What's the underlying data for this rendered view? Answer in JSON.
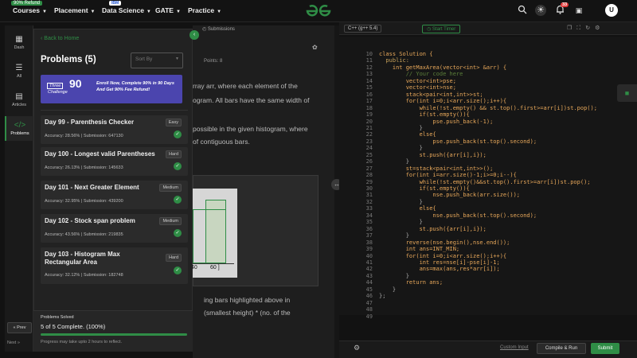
{
  "topnav": {
    "refund_badge": "90% Refund",
    "courses": "Courses",
    "placement": "Placement",
    "data_science": "Data Science",
    "ibm_badge": "IBM",
    "gate": "GATE",
    "practice": "Practice",
    "notifications": "33",
    "avatar_letter": "U"
  },
  "rail": {
    "dash": "Dash",
    "all": "All",
    "articles": "Articles",
    "problems": "Problems",
    "prev": "« Prev",
    "next": "Next »"
  },
  "description": {
    "tab_submissions": "Submissions",
    "points": "Points: 8",
    "line1": "rray arr, where each element of the",
    "line2": "ogram. All bars have the same width of",
    "line3": "possible in the given histogram, where",
    "line4": "of contiguous bars.",
    "line5": "ing bars highlighted above in",
    "line6": "(smallest height) * (no. of the",
    "hist_label1": "40",
    "hist_label2": "60 ]"
  },
  "panel": {
    "back": "Back to Home",
    "title": "Problems (5)",
    "sort_placeholder": "Sort By",
    "banner_number": "90",
    "banner_three": "Three",
    "banner_challenge": "Challenge",
    "banner_text": "Enroll Now, Complete 90% in 90 Days And Get 90% Fee Refund!",
    "problems": [
      {
        "title": "Day 99 - Parenthesis Checker",
        "difficulty": "Easy",
        "stats": "Accuracy: 28.56% | Submission: 647130"
      },
      {
        "title": "Day 100 - Longest valid Parentheses",
        "difficulty": "Hard",
        "stats": "Accuracy: 26.13% | Submission: 145633"
      },
      {
        "title": "Day 101 - Next Greater Element",
        "difficulty": "Medium",
        "stats": "Accuracy: 32.95% | Submission: 439200"
      },
      {
        "title": "Day 102 - Stock span problem",
        "difficulty": "Medium",
        "stats": "Accuracy: 43.56% | Submission: 219835"
      },
      {
        "title": "Day 103 - Histogram Max Rectangular Area",
        "difficulty": "Hard",
        "stats": "Accuracy: 32.12% | Submission: 182748"
      }
    ],
    "solved_label": "Problems Solved",
    "solved_count": "5 of 5 Complete. (100%)",
    "solved_fraction": 1.0,
    "solved_note": "Progress may take upto 2 hours to reflect."
  },
  "editor": {
    "language": "C++ (g++ 5.4)",
    "timer": "Start Timer",
    "custom_input": "Custom Input",
    "compile": "Compile & Run",
    "submit": "Submit",
    "lines": [
      {
        "n": "10",
        "t": "class Solution {",
        "c": ""
      },
      {
        "n": "11",
        "t": "  public:",
        "c": "k"
      },
      {
        "n": "12",
        "t": "    int getMaxArea(vector<int> &arr) {",
        "c": ""
      },
      {
        "n": "13",
        "t": "        // Your code here",
        "c": "c"
      },
      {
        "n": "14",
        "t": "        vector<int>pse;",
        "c": ""
      },
      {
        "n": "15",
        "t": "        vector<int>nse;",
        "c": ""
      },
      {
        "n": "16",
        "t": "        stack<pair<int,int>>st;",
        "c": ""
      },
      {
        "n": "17",
        "t": "        for(int i=0;i<arr.size();i++){",
        "c": ""
      },
      {
        "n": "18",
        "t": "            while(!st.empty() && st.top().first>=arr[i])st.pop();",
        "c": ""
      },
      {
        "n": "19",
        "t": "            if(st.empty()){",
        "c": ""
      },
      {
        "n": "20",
        "t": "                pse.push_back(-1);",
        "c": ""
      },
      {
        "n": "21",
        "t": "            }",
        "c": "p"
      },
      {
        "n": "22",
        "t": "            else{",
        "c": ""
      },
      {
        "n": "23",
        "t": "                pse.push_back(st.top().second);",
        "c": ""
      },
      {
        "n": "24",
        "t": "            }",
        "c": "p"
      },
      {
        "n": "25",
        "t": "            st.push({arr[i],i});",
        "c": ""
      },
      {
        "n": "26",
        "t": "        }",
        "c": "p"
      },
      {
        "n": "27",
        "t": "        st=stack<pair<int,int>>();",
        "c": ""
      },
      {
        "n": "28",
        "t": "        for(int i=arr.size()-1;i>=0;i--){",
        "c": ""
      },
      {
        "n": "29",
        "t": "            while(!st.empty()&&st.top().first>=arr[i])st.pop();",
        "c": ""
      },
      {
        "n": "30",
        "t": "            if(st.empty()){",
        "c": ""
      },
      {
        "n": "31",
        "t": "                nse.push_back(arr.size());",
        "c": ""
      },
      {
        "n": "32",
        "t": "            }",
        "c": "p"
      },
      {
        "n": "33",
        "t": "            else{",
        "c": ""
      },
      {
        "n": "34",
        "t": "                nse.push_back(st.top().second);",
        "c": ""
      },
      {
        "n": "35",
        "t": "            }",
        "c": "p"
      },
      {
        "n": "36",
        "t": "            st.push({arr[i],i});",
        "c": ""
      },
      {
        "n": "37",
        "t": "        }",
        "c": "p"
      },
      {
        "n": "38",
        "t": "        reverse(nse.begin(),nse.end());",
        "c": ""
      },
      {
        "n": "39",
        "t": "        int ans=INT_MIN;",
        "c": ""
      },
      {
        "n": "40",
        "t": "        for(int i=0;i<arr.size();i++){",
        "c": ""
      },
      {
        "n": "41",
        "t": "            int res=nse[i]-pse[i]-1;",
        "c": ""
      },
      {
        "n": "42",
        "t": "            ans=max(ans,res*arr[i]);",
        "c": ""
      },
      {
        "n": "43",
        "t": "        }",
        "c": "p"
      },
      {
        "n": "44",
        "t": "        return ans;",
        "c": ""
      },
      {
        "n": "45",
        "t": "    }",
        "c": "p"
      },
      {
        "n": "46",
        "t": "};",
        "c": "p"
      },
      {
        "n": "47",
        "t": "",
        "c": ""
      },
      {
        "n": "48",
        "t": "",
        "c": ""
      },
      {
        "n": "49",
        "t": "",
        "c": ""
      }
    ]
  },
  "colors": {
    "accent": "#2f8d46",
    "background": "#121212",
    "panel": "#222222"
  }
}
